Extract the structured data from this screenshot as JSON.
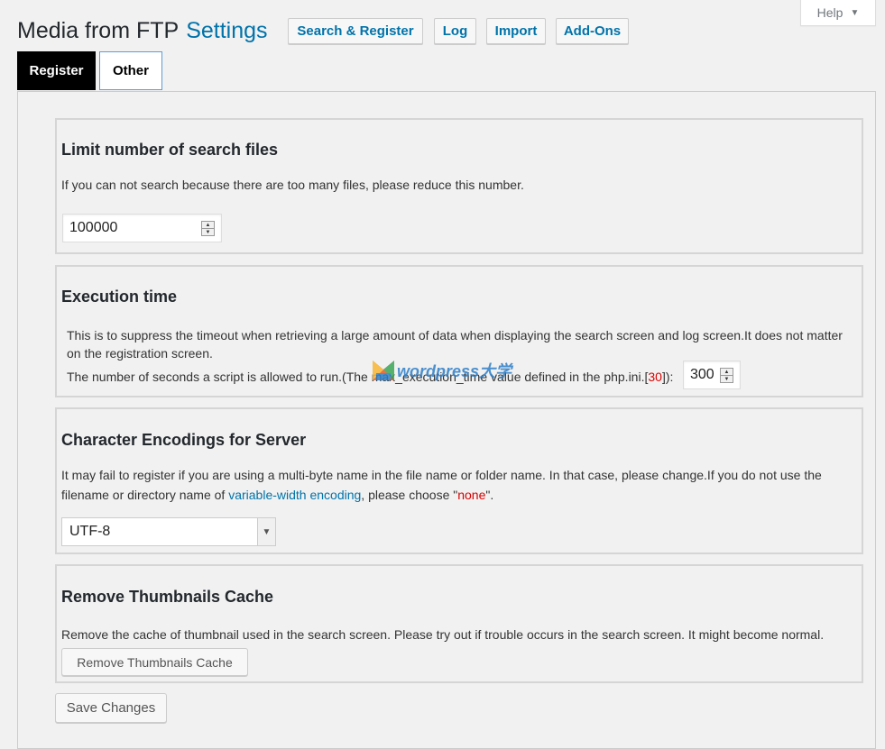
{
  "help": {
    "label": "Help"
  },
  "header": {
    "title_main": "Media from FTP",
    "title_accent": "Settings",
    "buttons": [
      "Search & Register",
      "Log",
      "Import",
      "Add-Ons"
    ]
  },
  "tabs": [
    {
      "label": "Register",
      "active": false
    },
    {
      "label": "Other",
      "active": true
    }
  ],
  "sections": {
    "limit": {
      "title": "Limit number of search files",
      "description": "If you can not search because there are too many files, please reduce this number.",
      "value": "100000"
    },
    "execution": {
      "title": "Execution time",
      "description": "This is to suppress the timeout when retrieving a large amount of data when displaying the search screen and log screen.It does not matter on the registration screen.",
      "line_prefix": "The number of seconds a script is allowed to run.(The max_execution_time value defined in the php.ini.[",
      "php_value": "30",
      "line_suffix": "]):",
      "value": "300"
    },
    "encoding": {
      "title": "Character Encodings for Server",
      "desc_part1": "It may fail to register if you are using a multi-byte name in the file name or folder name. In that case, please change.If you do not use the filename or directory name of ",
      "desc_link": "variable-width encoding",
      "desc_part2": ", please choose \"",
      "desc_none": "none",
      "desc_part3": "\".",
      "selected": "UTF-8"
    },
    "thumbnails": {
      "title": "Remove Thumbnails Cache",
      "description": "Remove the cache of thumbnail used in the search screen. Please try out if trouble occurs in the search screen. It might become normal.",
      "button": "Remove Thumbnails Cache"
    }
  },
  "save_button": "Save Changes",
  "watermark": {
    "text": "wordpress大学"
  },
  "colors": {
    "accent": "#0073aa",
    "red": "#dd0000"
  }
}
